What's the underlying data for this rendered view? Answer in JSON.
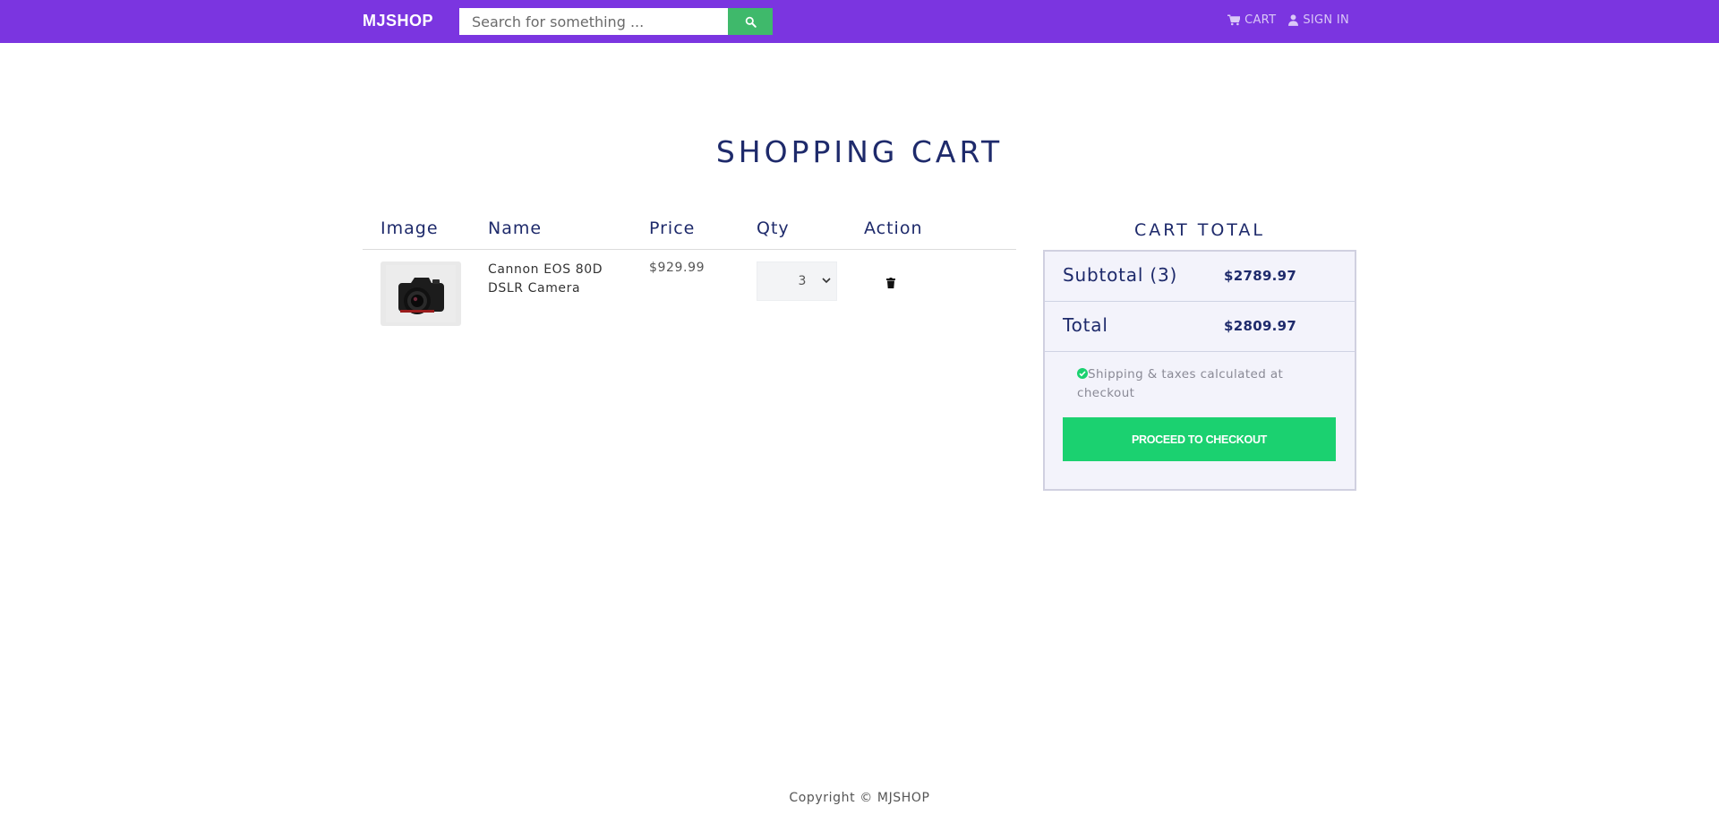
{
  "navbar": {
    "brand": "MJSHOP",
    "search_placeholder": "Search for something ...",
    "links": [
      {
        "label": "CART",
        "icon": "shopping-cart-icon"
      },
      {
        "label": "SIGN IN",
        "icon": "user-icon"
      }
    ]
  },
  "page_title": "SHOPPING CART",
  "cart_table": {
    "headers": [
      "Image",
      "Name",
      "Price",
      "Qty",
      "Action"
    ],
    "rows": [
      {
        "name": "Cannon EOS 80D DSLR Camera",
        "price": "$929.99",
        "qty": "3",
        "image_icon": "camera-icon",
        "action_icon": "trash-icon"
      }
    ]
  },
  "cart_total": {
    "heading": "CART TOTAL",
    "subtotal_label": "Subtotal (3)",
    "subtotal_value": "$2789.97",
    "total_label": "Total",
    "total_value": "$2809.97",
    "shipping_note": "Shipping & taxes calculated at checkout",
    "checkout_label": "PROCEED TO CHECKOUT"
  },
  "footer": "Copyright © MJSHOP",
  "colors": {
    "navbar": "#7b35e0",
    "search_button": "#3fb96b",
    "checkout_button": "#1bd170",
    "heading_text": "#1e2a6b",
    "total_box_bg": "#f3f3fb"
  }
}
